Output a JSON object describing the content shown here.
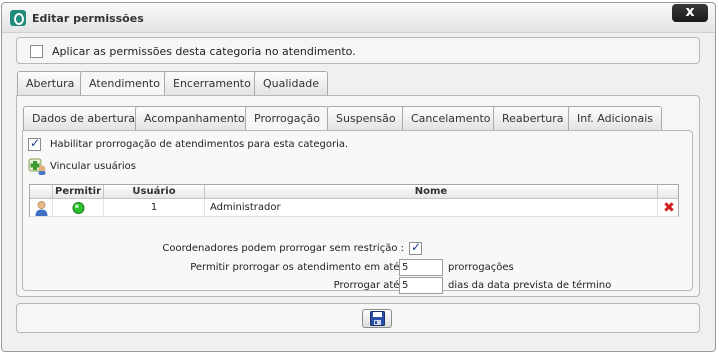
{
  "window": {
    "title": "Editar permissões",
    "close_label": "x"
  },
  "apply_all": {
    "label": "Aplicar as permissões desta categoria no atendimento.",
    "checked": false
  },
  "main_tabs": [
    {
      "label": "Abertura",
      "active": false
    },
    {
      "label": "Atendimento",
      "active": true
    },
    {
      "label": "Encerramento",
      "active": false
    },
    {
      "label": "Qualidade",
      "active": false
    }
  ],
  "sub_tabs": [
    {
      "label": "Dados de abertura",
      "active": false
    },
    {
      "label": "Acompanhamento",
      "active": false
    },
    {
      "label": "Prorrogação",
      "active": true
    },
    {
      "label": "Suspensão",
      "active": false
    },
    {
      "label": "Cancelamento",
      "active": false
    },
    {
      "label": "Reabertura",
      "active": false
    },
    {
      "label": "Inf. Adicionais",
      "active": false
    }
  ],
  "enable_extension": {
    "label": "Habilitar prorrogação de atendimentos para esta categoria.",
    "checked": true
  },
  "link_users": {
    "label": "Vincular usuários"
  },
  "users_table": {
    "columns": [
      "Permitir",
      "Usuário",
      "Nome"
    ],
    "rows": [
      {
        "permitir": true,
        "usuario": "1",
        "nome": "Administrador"
      }
    ]
  },
  "settings": {
    "coordinators_label": "Coordenadores podem prorrogar sem restrição :",
    "coordinators_checked": true,
    "max_ext_label": "Permitir prorrogar os atendimento em até :",
    "max_ext_value": "5",
    "max_ext_suffix": "prorrogações",
    "extend_label": "Prorrogar até :",
    "extend_value": "5",
    "extend_suffix": "dias da data prevista de término"
  },
  "colors": {
    "accent": "#1f8b7a",
    "save_blue": "#2a4fa8",
    "delete_red": "#d21f1f"
  }
}
